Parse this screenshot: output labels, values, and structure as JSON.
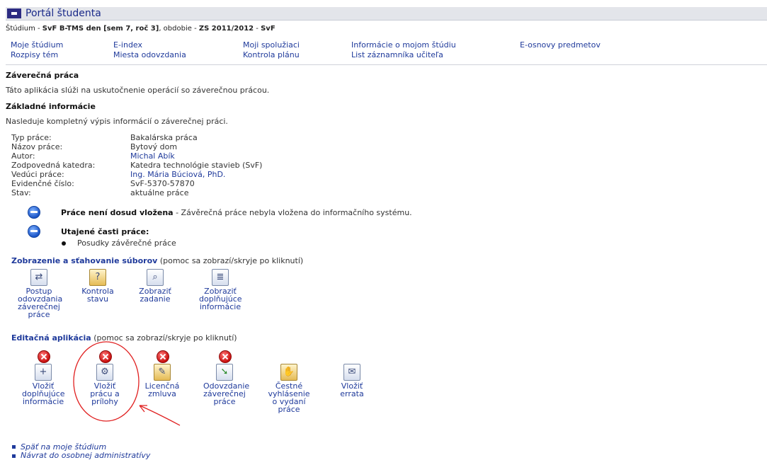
{
  "app": {
    "title": "Portál študenta"
  },
  "context": {
    "study_label": "Štúdium",
    "study_value": "SvF B-TMS den [sem 7, roč 3]",
    "period_label": "obdobie",
    "period_value": "ZS 2011/2012",
    "faculty": "SvF",
    "separator": " - "
  },
  "nav": [
    {
      "label": "Moje štúdium"
    },
    {
      "label": "E-index"
    },
    {
      "label": "Moji spolužiaci"
    },
    {
      "label": "Informácie o mojom štúdiu"
    },
    {
      "label": "E-osnovy predmetov"
    },
    {
      "label": "Rozpisy tém"
    },
    {
      "label": "Miesta odovzdania"
    },
    {
      "label": "Kontrola plánu"
    },
    {
      "label": "List záznamníka učiteľa"
    }
  ],
  "thesis": {
    "heading": "Záverečná práca",
    "description": "Táto aplikácia slúži na uskutočnenie operácií so záverečnou prácou."
  },
  "basic": {
    "heading": "Základné informácie",
    "description": "Nasleduje kompletný výpis informácií o záverečnej práci.",
    "rows": [
      {
        "label": "Typ práce:",
        "value": "Bakalárska práca"
      },
      {
        "label": "Názov práce:",
        "value": "Bytový dom"
      },
      {
        "label": "Autor:",
        "value": "Michal Abík"
      },
      {
        "label": "Zodpovedná katedra:",
        "value": "Katedra technológie stavieb (SvF)"
      },
      {
        "label": "Vedúci práce:",
        "value": "Ing. Mária Búciová, PhD."
      },
      {
        "label": "Evidenčné číslo:",
        "value": "SvF-5370-57870"
      },
      {
        "label": "Stav:",
        "value": "aktuálne práce"
      }
    ]
  },
  "notices": {
    "not_inserted_bold": "Práce není dosud vložena",
    "not_inserted_text": " - Závěrečná práce nebyla vložena do informačního systému.",
    "secret_heading": "Utajené časti práce:",
    "secret_item": "Posudky závěrečné práce"
  },
  "files": {
    "heading": "Zobrazenie a sťahovanie súborov",
    "help": " (pomoc sa zobrazí/skryje po kliknutí)",
    "tools": [
      {
        "label": "Postup odovzdania záverečnej práce",
        "icon": "flow-arrows-icon"
      },
      {
        "label": "Kontrola stavu",
        "icon": "check-document-icon"
      },
      {
        "label": "Zobraziť zadanie",
        "icon": "magnifier-icon"
      },
      {
        "label": "Zobraziť doplňujúce informácie",
        "icon": "list-document-icon"
      }
    ]
  },
  "edit": {
    "heading": "Editačná aplikácia",
    "help": " (pomoc sa zobrazí/skryje po kliknutí)",
    "tools": [
      {
        "label": "Vložiť doplňujúce informácie",
        "icon": "insert-info-icon",
        "blocked": true
      },
      {
        "label": "Vložiť prácu a prílohy",
        "icon": "insert-thesis-icon",
        "blocked": true
      },
      {
        "label": "Licenčná zmluva",
        "icon": "license-pen-icon",
        "blocked": true
      },
      {
        "label": "Odovzdanie záverečnej práce",
        "icon": "submit-arrow-icon",
        "blocked": true
      },
      {
        "label": "Čestné vyhlásenie o vydaní práce",
        "icon": "hand-document-icon",
        "blocked": false
      },
      {
        "label": "Vložiť errata",
        "icon": "errata-document-icon",
        "blocked": false
      }
    ]
  },
  "footer": {
    "links": [
      {
        "label": "Späť na moje štúdium"
      },
      {
        "label": "Návrat do osobnej administratívy"
      }
    ]
  },
  "colors": {
    "link": "#1f3a9b",
    "title_square": "#2c2b82",
    "annotation": "#e02020"
  }
}
